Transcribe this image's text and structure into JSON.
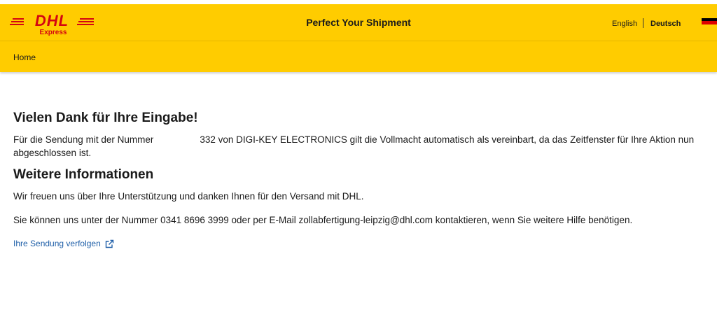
{
  "brand": {
    "logo_text": "DHL",
    "logo_subtext": "Express"
  },
  "header": {
    "title": "Perfect Your Shipment",
    "languages": [
      "English",
      "Deutsch"
    ],
    "active_language": "Deutsch"
  },
  "nav": {
    "home": "Home"
  },
  "main": {
    "heading": "Vielen Dank für Ihre Eingabe!",
    "intro_before": "Für die Sendung mit der Nummer",
    "intro_after": "332 von DIGI-KEY ELECTRONICS gilt die Vollmacht automatisch als vereinbart, da das Zeitfenster für Ihre Aktion nun abgeschlossen ist.",
    "subheading": "Weitere Informationen",
    "thanks": "Wir freuen uns über Ihre Unterstützung und danken Ihnen für den Versand mit DHL.",
    "contact": "Sie können uns unter der Nummer 0341 8696 3999 oder per E-Mail zollabfertigung-leipzig@dhl.com kontaktieren, wenn Sie weitere Hilfe benötigen.",
    "track_link": "Ihre Sendung verfolgen"
  },
  "colors": {
    "dhl_yellow": "#ffcc00",
    "dhl_red": "#d40511",
    "link": "#1f5fa8"
  },
  "icons": {
    "flag": "germany-flag-icon",
    "external": "external-link-icon"
  }
}
